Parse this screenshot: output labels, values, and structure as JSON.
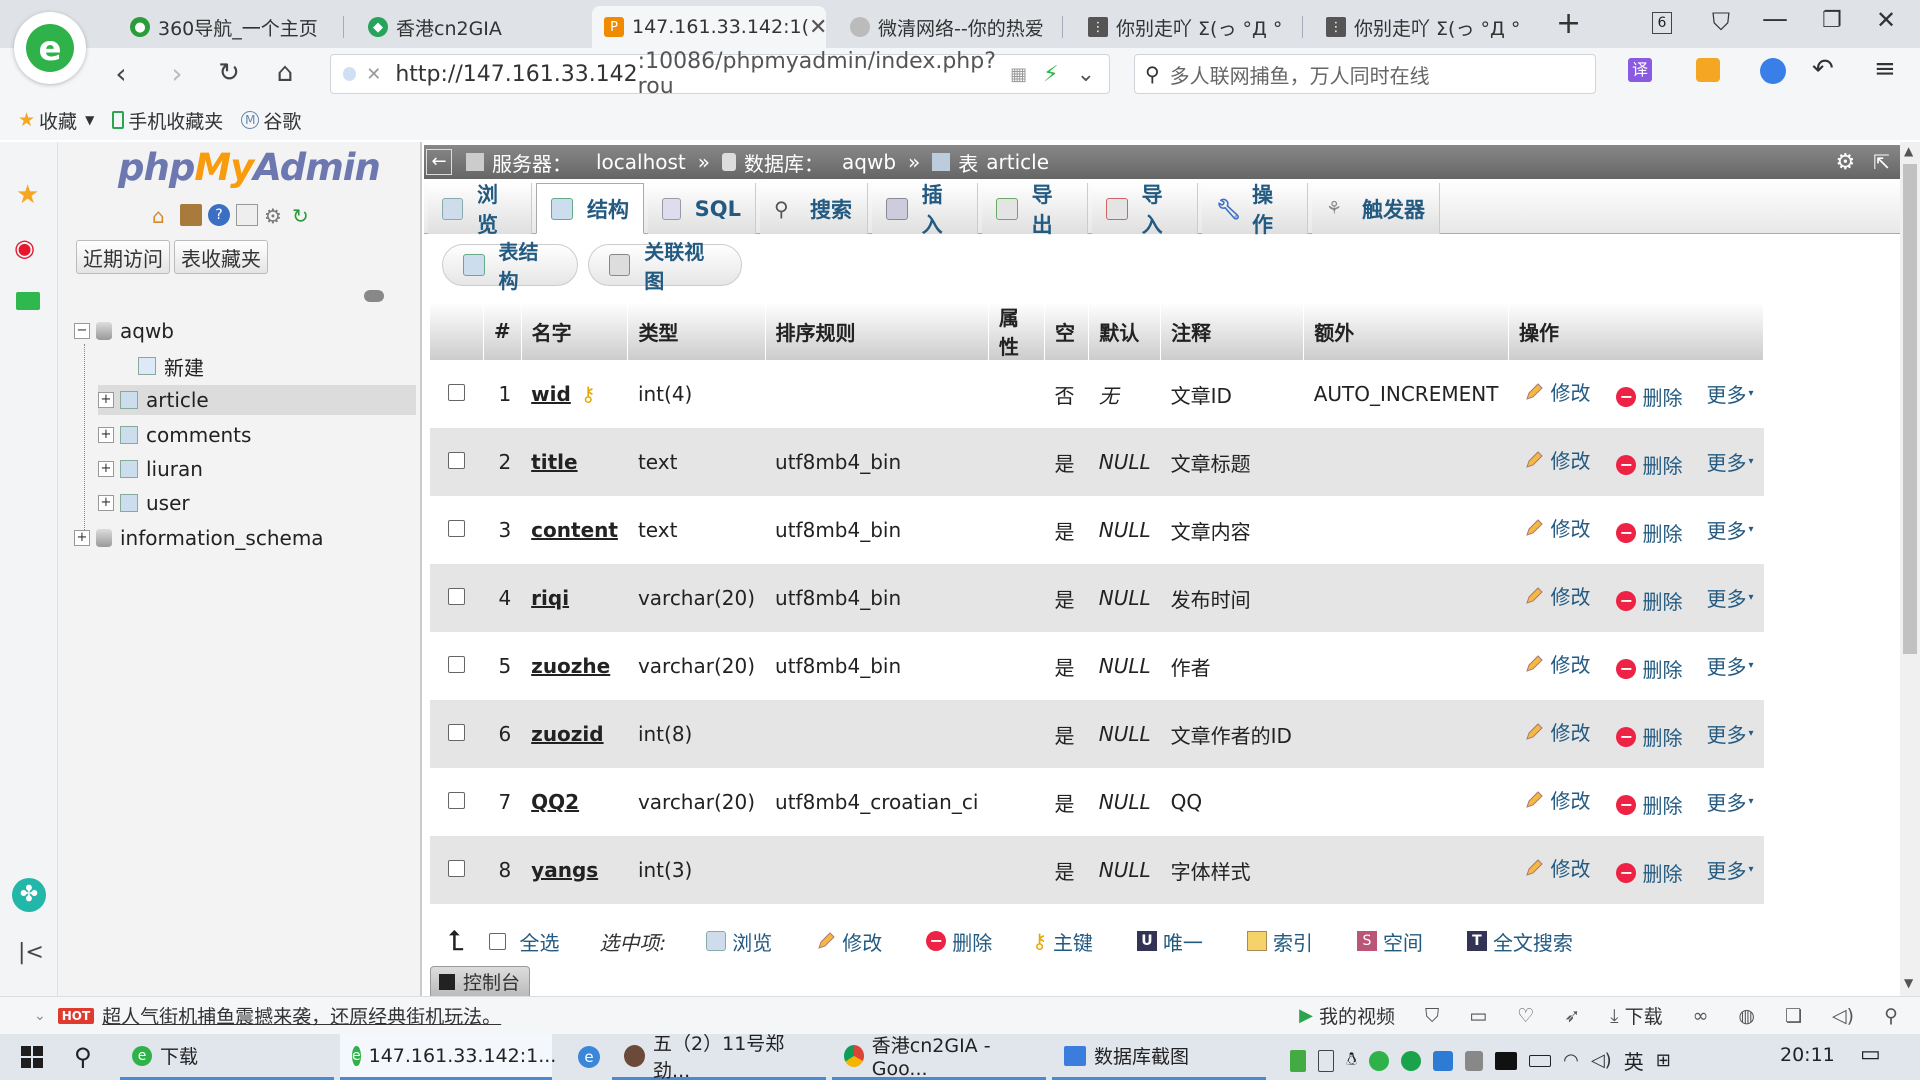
{
  "browser": {
    "tabs": [
      {
        "label": "360导航_一个主页",
        "icon_color": "#2a9d3a",
        "active": false
      },
      {
        "label": "香港cn2GIA",
        "icon_color": "#27a35b",
        "active": false
      },
      {
        "label": "147.161.33.142:1(",
        "icon_color": "#f08a00",
        "active": true
      },
      {
        "label": "微清网络--你的热爱",
        "icon_color": "#bbb",
        "active": false
      },
      {
        "label": "你别走吖 Σ(っ °Д °",
        "icon_color": "#555",
        "active": false
      },
      {
        "label": "你别走吖 Σ(っ °Д °",
        "icon_color": "#555",
        "active": false
      }
    ],
    "new_tab": "+",
    "tab_count": "6",
    "url_host": "http://147.161.33.142",
    "url_rest": ":10086/phpmyadmin/index.php?rou",
    "search_placeholder": "多人联网捕鱼，万人同时在线",
    "bookmarks": [
      "收藏",
      "手机收藏夹",
      "谷歌"
    ]
  },
  "pma": {
    "logo_php": "php",
    "logo_my": "My",
    "logo_admin": "Admin",
    "recent_label": "近期访问",
    "favorites_label": "表收藏夹",
    "tree": {
      "db1": "aqwb",
      "new": "新建",
      "tables": [
        "article",
        "comments",
        "liuran",
        "user"
      ],
      "db2": "information_schema"
    },
    "breadcrumb": {
      "server_label": "服务器：",
      "server": "localhost",
      "db_label": "数据库：",
      "db": "aqwb",
      "table_label": "表",
      "table": "article"
    },
    "tabs": [
      "浏览",
      "结构",
      "SQL",
      "搜索",
      "插入",
      "导出",
      "导入",
      "操作",
      "触发器"
    ],
    "active_tab": "结构",
    "subtabs": [
      "表结构",
      "关联视图"
    ],
    "columns": [
      "#",
      "名字",
      "类型",
      "排序规则",
      "属性",
      "空",
      "默认",
      "注释",
      "额外",
      "操作"
    ],
    "rows": [
      {
        "n": "1",
        "name": "wid",
        "type": "int(4)",
        "collation": "",
        "attr": "",
        "null": "否",
        "default": "无",
        "comment": "文章ID",
        "extra": "AUTO_INCREMENT"
      },
      {
        "n": "2",
        "name": "title",
        "type": "text",
        "collation": "utf8mb4_bin",
        "attr": "",
        "null": "是",
        "default": "NULL",
        "comment": "文章标题",
        "extra": ""
      },
      {
        "n": "3",
        "name": "content",
        "type": "text",
        "collation": "utf8mb4_bin",
        "attr": "",
        "null": "是",
        "default": "NULL",
        "comment": "文章内容",
        "extra": ""
      },
      {
        "n": "4",
        "name": "riqi",
        "type": "varchar(20)",
        "collation": "utf8mb4_bin",
        "attr": "",
        "null": "是",
        "default": "NULL",
        "comment": "发布时间",
        "extra": ""
      },
      {
        "n": "5",
        "name": "zuozhe",
        "type": "varchar(20)",
        "collation": "utf8mb4_bin",
        "attr": "",
        "null": "是",
        "default": "NULL",
        "comment": "作者",
        "extra": ""
      },
      {
        "n": "6",
        "name": "zuozid",
        "type": "int(8)",
        "collation": "",
        "attr": "",
        "null": "是",
        "default": "NULL",
        "comment": "文章作者的ID",
        "extra": ""
      },
      {
        "n": "7",
        "name": "QQ2",
        "type": "varchar(20)",
        "collation": "utf8mb4_croatian_ci",
        "attr": "",
        "null": "是",
        "default": "NULL",
        "comment": "QQ",
        "extra": ""
      },
      {
        "n": "8",
        "name": "yangs",
        "type": "int(3)",
        "collation": "",
        "attr": "",
        "null": "是",
        "default": "NULL",
        "comment": "字体样式",
        "extra": ""
      }
    ],
    "row_actions": {
      "edit": "修改",
      "delete": "删除",
      "more": "更多"
    },
    "bulk": {
      "select_all": "全选",
      "selected": "选中项:",
      "actions": [
        "浏览",
        "修改",
        "删除",
        "主键",
        "唯一",
        "索引",
        "空间",
        "全文搜索"
      ]
    },
    "console": "控制台"
  },
  "statusbar": {
    "ad_badge": "HOT",
    "ad_text": "超人气街机捕鱼震撼来袭，还原经典街机玩法。",
    "my_video": "我的视频",
    "download": "下载"
  },
  "taskbar": {
    "items": [
      "下载",
      "147.161.33.142:1...",
      "五（2）11号郑劲...",
      "香港cn2GIA - Goo...",
      "数据库截图"
    ],
    "ime": "英",
    "time": "20:11"
  }
}
